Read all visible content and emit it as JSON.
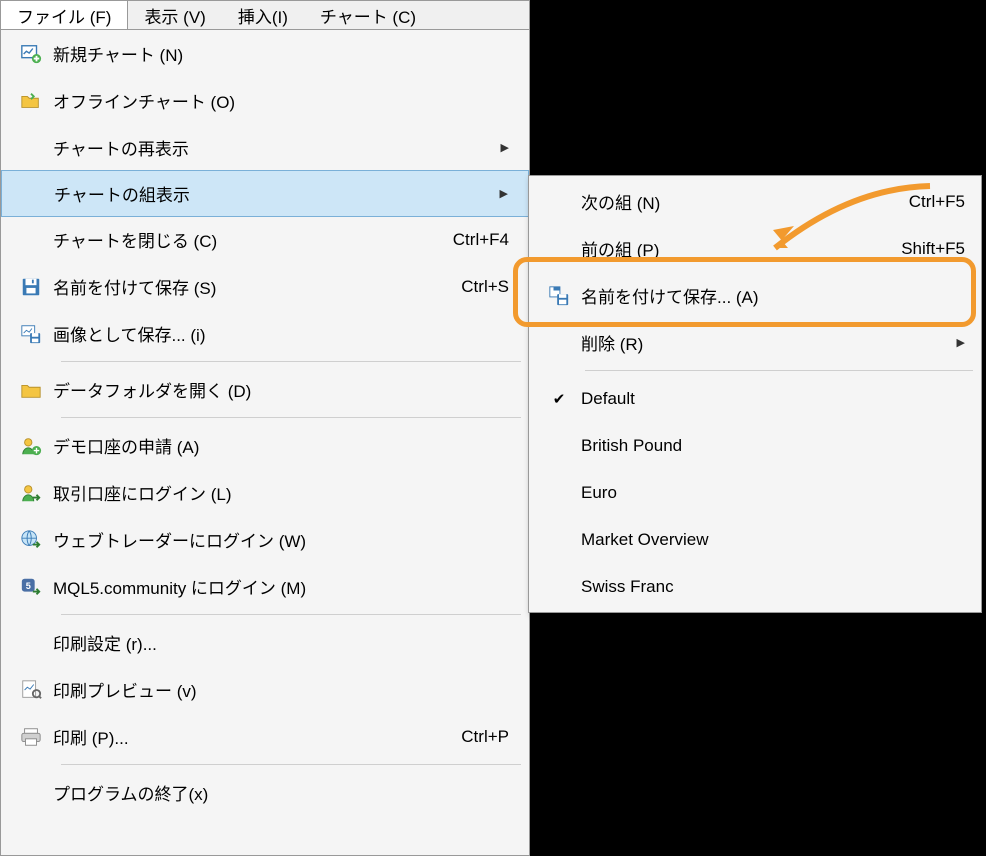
{
  "menubar": {
    "items": [
      {
        "label": "ファイル (F)",
        "active": true
      },
      {
        "label": "表示 (V)",
        "active": false
      },
      {
        "label": "挿入(I)",
        "active": false
      },
      {
        "label": "チャート (C)",
        "active": false
      }
    ]
  },
  "file_menu": {
    "items": [
      {
        "icon": "new-chart-icon",
        "label": "新規チャート (N)"
      },
      {
        "icon": "folder-open-icon",
        "label": "オフラインチャート (O)"
      },
      {
        "indented": true,
        "label": "チャートの再表示",
        "submenu": true
      },
      {
        "indented": true,
        "label": "チャートの組表示",
        "submenu": true,
        "highlighted": true
      },
      {
        "indented": true,
        "label": "チャートを閉じる (C)",
        "shortcut": "Ctrl+F4"
      },
      {
        "icon": "save-icon",
        "label": "名前を付けて保存 (S)",
        "shortcut": "Ctrl+S"
      },
      {
        "icon": "save-image-icon",
        "label": "画像として保存... (i)"
      },
      {
        "separator": true
      },
      {
        "icon": "folder-icon",
        "label": "データフォルダを開く (D)"
      },
      {
        "separator": true
      },
      {
        "icon": "user-add-icon",
        "label": "デモ口座の申請 (A)"
      },
      {
        "icon": "user-login-icon",
        "label": "取引口座にログイン (L)"
      },
      {
        "icon": "globe-icon",
        "label": "ウェブトレーダーにログイン (W)"
      },
      {
        "icon": "mql5-icon",
        "label": "MQL5.community にログイン (M)"
      },
      {
        "separator": true
      },
      {
        "indented": true,
        "label": "印刷設定 (r)..."
      },
      {
        "icon": "print-preview-icon",
        "label": "印刷プレビュー (v)"
      },
      {
        "icon": "print-icon",
        "label": "印刷 (P)...",
        "shortcut": "Ctrl+P"
      },
      {
        "separator": true
      },
      {
        "indented": true,
        "label": "プログラムの終了(x)"
      }
    ]
  },
  "profile_submenu": {
    "items": [
      {
        "label": "次の組 (N)",
        "shortcut": "Ctrl+F5"
      },
      {
        "label": "前の組 (P)",
        "shortcut": "Shift+F5"
      },
      {
        "icon": "save-profile-icon",
        "label": "名前を付けて保存... (A)",
        "highlighted_box": true
      },
      {
        "label": "削除 (R)",
        "submenu": true
      },
      {
        "separator": true
      },
      {
        "checked": true,
        "label": "Default"
      },
      {
        "label": "British Pound"
      },
      {
        "label": "Euro"
      },
      {
        "label": "Market Overview"
      },
      {
        "label": "Swiss Franc"
      }
    ]
  }
}
